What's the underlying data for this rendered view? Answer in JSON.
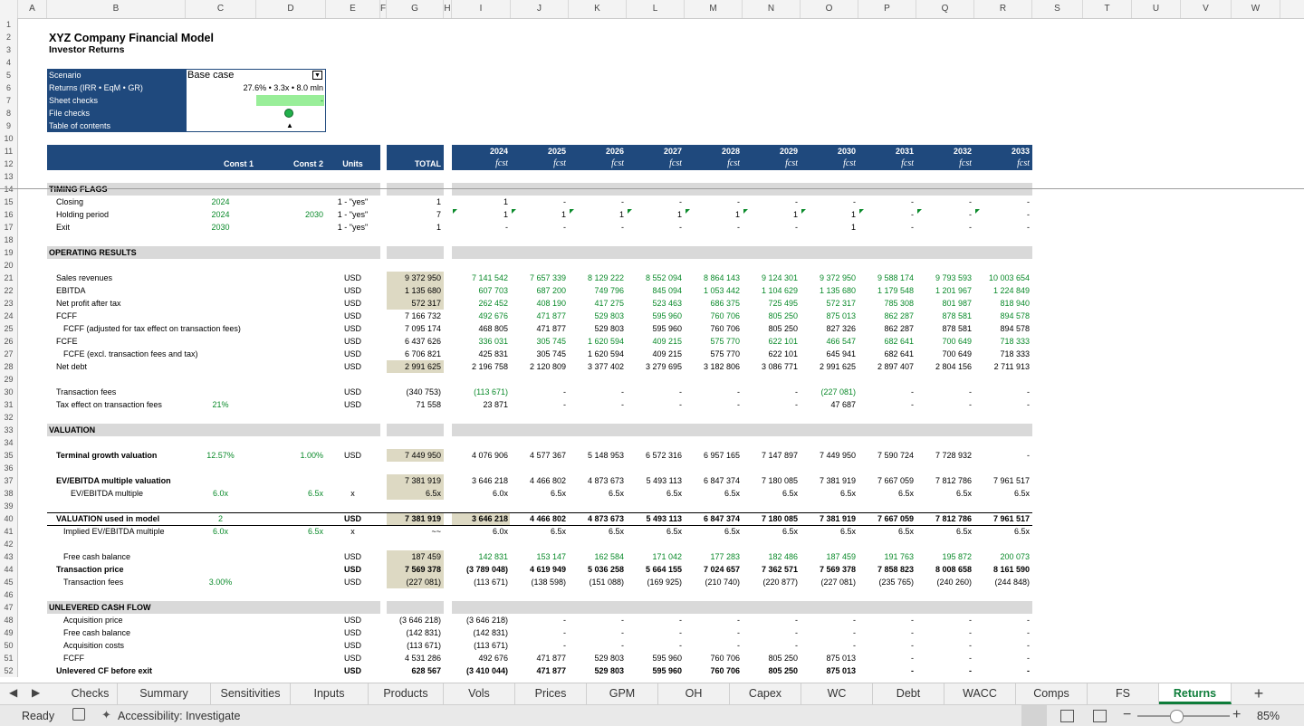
{
  "header": {
    "title": "XYZ Company Financial Model",
    "subtitle": "Investor Returns"
  },
  "columns": [
    "A",
    "B",
    "C",
    "D",
    "E",
    "F",
    "G",
    "H",
    "I",
    "J",
    "K",
    "L",
    "M",
    "N",
    "O",
    "P",
    "Q",
    "R",
    "S",
    "T",
    "U",
    "V",
    "W"
  ],
  "rows": [
    "1",
    "2",
    "3",
    "4",
    "5",
    "6",
    "7",
    "8",
    "9",
    "10",
    "11",
    "12",
    "13",
    "14",
    "15",
    "16",
    "17",
    "18",
    "19",
    "20",
    "21",
    "22",
    "23",
    "24",
    "25",
    "26",
    "27",
    "28",
    "29",
    "30",
    "31",
    "32",
    "33",
    "34",
    "35",
    "36",
    "37",
    "38",
    "39",
    "40",
    "41",
    "42",
    "43",
    "44",
    "45",
    "46",
    "47",
    "48",
    "49",
    "50",
    "51",
    "52"
  ],
  "info_box": {
    "scenario_label": "Scenario",
    "scenario_value": "Base case",
    "dropdown_icon": "dropdown-arrow-icon",
    "returns_label": "Returns (IRR • EqM • GR)",
    "returns_value": "27.6% • 3.3x • 8.0 mln",
    "sheet_checks_label": "Sheet checks",
    "sheet_checks_value": "-",
    "file_checks_label": "File checks",
    "file_checks_icon": "green-circle-icon",
    "toc_label": "Table of contents",
    "toc_icon": "up-arrow-icon",
    "toc_glyph": "▲"
  },
  "table_header": {
    "const1": "Const 1",
    "const2": "Const 2",
    "units": "Units",
    "total": "TOTAL",
    "years": [
      "2024",
      "2025",
      "2026",
      "2027",
      "2028",
      "2029",
      "2030",
      "2031",
      "2032",
      "2033"
    ],
    "fcst": "fcst"
  },
  "sections": {
    "timing": "TIMING FLAGS",
    "operating": "OPERATING RESULTS",
    "valuation": "VALUATION",
    "unlevered": "UNLEVERED CASH FLOW"
  },
  "timing_rows": [
    {
      "label": "Closing",
      "c1": "2024",
      "c2": "",
      "units": "1 - \"yes\"",
      "total": "1",
      "vals": [
        "1",
        "-",
        "-",
        "-",
        "-",
        "-",
        "-",
        "-",
        "-",
        "-"
      ]
    },
    {
      "label": "Holding period",
      "c1": "2024",
      "c2": "2030",
      "units": "1 - \"yes\"",
      "total": "7",
      "vals": [
        "1",
        "1",
        "1",
        "1",
        "1",
        "1",
        "1",
        "-",
        "-",
        "-"
      ]
    },
    {
      "label": "Exit",
      "c1": "2030",
      "c2": "",
      "units": "1 - \"yes\"",
      "total": "1",
      "vals": [
        "-",
        "-",
        "-",
        "-",
        "-",
        "-",
        "1",
        "-",
        "-",
        "-"
      ]
    }
  ],
  "operating_rows": [
    {
      "label": "Sales revenues",
      "units": "USD",
      "total": "9 372 950",
      "vals": [
        "7 141 542",
        "7 657 339",
        "8 129 222",
        "8 552 094",
        "8 864 143",
        "9 124 301",
        "9 372 950",
        "9 588 174",
        "9 793 593",
        "10 003 654"
      ]
    },
    {
      "label": "EBITDA",
      "units": "USD",
      "total": "1 135 680",
      "vals": [
        "607 703",
        "687 200",
        "749 796",
        "845 094",
        "1 053 442",
        "1 104 629",
        "1 135 680",
        "1 179 548",
        "1 201 967",
        "1 224 849"
      ]
    },
    {
      "label": "Net profit after tax",
      "units": "USD",
      "total": "572 317",
      "vals": [
        "262 452",
        "408 190",
        "417 275",
        "523 463",
        "686 375",
        "725 495",
        "572 317",
        "785 308",
        "801 987",
        "818 940"
      ]
    },
    {
      "label": "FCFF",
      "units": "USD",
      "total": "7 166 732",
      "vals": [
        "492 676",
        "471 877",
        "529 803",
        "595 960",
        "760 706",
        "805 250",
        "875 013",
        "862 287",
        "878 581",
        "894 578"
      ]
    },
    {
      "label": "FCFF (adjusted for tax effect on transaction fees)",
      "units": "USD",
      "total": "7 095 174",
      "vals": [
        "468 805",
        "471 877",
        "529 803",
        "595 960",
        "760 706",
        "805 250",
        "827 326",
        "862 287",
        "878 581",
        "894 578"
      ]
    },
    {
      "label": "FCFE",
      "units": "USD",
      "total": "6 437 626",
      "vals": [
        "336 031",
        "305 745",
        "1 620 594",
        "409 215",
        "575 770",
        "622 101",
        "466 547",
        "682 641",
        "700 649",
        "718 333"
      ]
    },
    {
      "label": "FCFE (excl. transaction fees and tax)",
      "units": "USD",
      "total": "6 706 821",
      "vals": [
        "425 831",
        "305 745",
        "1 620 594",
        "409 215",
        "575 770",
        "622 101",
        "645 941",
        "682 641",
        "700 649",
        "718 333"
      ]
    },
    {
      "label": "Net debt",
      "units": "USD",
      "total": "2 991 625",
      "vals": [
        "2 196 758",
        "2 120 809",
        "3 377 402",
        "3 279 695",
        "3 182 806",
        "3 086 771",
        "2 991 625",
        "2 897 407",
        "2 804 156",
        "2 711 913"
      ]
    }
  ],
  "fee_rows": [
    {
      "label": "Transaction fees",
      "c1": "",
      "units": "USD",
      "total": "(340 753)",
      "vals": [
        "(113 671)",
        "-",
        "-",
        "-",
        "-",
        "-",
        "(227 081)",
        "-",
        "-",
        "-"
      ]
    },
    {
      "label": "Tax effect on transaction fees",
      "c1": "21%",
      "units": "USD",
      "total": "71 558",
      "vals": [
        "23 871",
        "-",
        "-",
        "-",
        "-",
        "-",
        "47 687",
        "-",
        "-",
        "-"
      ]
    }
  ],
  "valuation_rows": {
    "terminal": {
      "label": "Terminal growth valuation",
      "c1": "12.57%",
      "c2": "1.00%",
      "units": "USD",
      "total": "7 449 950",
      "vals": [
        "4 076 906",
        "4 577 367",
        "5 148 953",
        "6 572 316",
        "6 957 165",
        "7 147 897",
        "7 449 950",
        "7 590 724",
        "7 728 932",
        "-"
      ]
    },
    "ev": {
      "label": "EV/EBITDA multiple valuation",
      "units": "",
      "total": "7 381 919",
      "vals": [
        "3 646 218",
        "4 466 802",
        "4 873 673",
        "5 493 113",
        "6 847 374",
        "7 180 085",
        "7 381 919",
        "7 667 059",
        "7 812 786",
        "7 961 517"
      ]
    },
    "evmult": {
      "label": "EV/EBITDA multiple",
      "c1": "6.0x",
      "c2": "6.5x",
      "units": "x",
      "total": "6.5x",
      "vals": [
        "6.0x",
        "6.5x",
        "6.5x",
        "6.5x",
        "6.5x",
        "6.5x",
        "6.5x",
        "6.5x",
        "6.5x",
        "6.5x"
      ]
    },
    "used": {
      "label": "VALUATION used in model",
      "c1": "2",
      "units": "USD",
      "total": "7 381 919",
      "vals": [
        "3 646 218",
        "4 466 802",
        "4 873 673",
        "5 493 113",
        "6 847 374",
        "7 180 085",
        "7 381 919",
        "7 667 059",
        "7 812 786",
        "7 961 517"
      ]
    },
    "implied": {
      "label": "Implied EV/EBITDA multiple",
      "c1": "6.0x",
      "c2": "6.5x",
      "units": "x",
      "total": "~~",
      "vals": [
        "6.0x",
        "6.5x",
        "6.5x",
        "6.5x",
        "6.5x",
        "6.5x",
        "6.5x",
        "6.5x",
        "6.5x",
        "6.5x"
      ]
    },
    "fcb": {
      "label": "Free cash balance",
      "units": "USD",
      "total": "187 459",
      "vals": [
        "142 831",
        "153 147",
        "162 584",
        "171 042",
        "177 283",
        "182 486",
        "187 459",
        "191 763",
        "195 872",
        "200 073"
      ]
    },
    "price": {
      "label": "Transaction price",
      "units": "USD",
      "total": "7 569 378",
      "vals": [
        "(3 789 048)",
        "4 619 949",
        "5 036 258",
        "5 664 155",
        "7 024 657",
        "7 362 571",
        "7 569 378",
        "7 858 823",
        "8 008 658",
        "8 161 590"
      ]
    },
    "tfees": {
      "label": "Transaction fees",
      "c1": "3.00%",
      "units": "USD",
      "total": "(227 081)",
      "vals": [
        "(113 671)",
        "(138 598)",
        "(151 088)",
        "(169 925)",
        "(210 740)",
        "(220 877)",
        "(227 081)",
        "(235 765)",
        "(240 260)",
        "(244 848)"
      ]
    }
  },
  "unlevered_rows": [
    {
      "label": "Acquisition price",
      "units": "USD",
      "total": "(3 646 218)",
      "vals": [
        "(3 646 218)",
        "-",
        "-",
        "-",
        "-",
        "-",
        "-",
        "-",
        "-",
        "-"
      ]
    },
    {
      "label": "Free cash balance",
      "units": "USD",
      "total": "(142 831)",
      "vals": [
        "(142 831)",
        "-",
        "-",
        "-",
        "-",
        "-",
        "-",
        "-",
        "-",
        "-"
      ]
    },
    {
      "label": "Acquisition costs",
      "units": "USD",
      "total": "(113 671)",
      "vals": [
        "(113 671)",
        "-",
        "-",
        "-",
        "-",
        "-",
        "-",
        "-",
        "-",
        "-"
      ]
    },
    {
      "label": "FCFF",
      "units": "USD",
      "total": "4 531 286",
      "vals": [
        "492 676",
        "471 877",
        "529 803",
        "595 960",
        "760 706",
        "805 250",
        "875 013",
        "-",
        "-",
        "-"
      ]
    },
    {
      "label": "Unlevered CF before exit",
      "units": "USD",
      "total": "628 567",
      "vals": [
        "(3 410 044)",
        "471 877",
        "529 803",
        "595 960",
        "760 706",
        "805 250",
        "875 013",
        "-",
        "-",
        "-"
      ]
    }
  ],
  "tabs": [
    "Checks",
    "Summary",
    "Sensitivities",
    "Inputs",
    "Products",
    "Vols",
    "Prices",
    "GPM",
    "OH",
    "Capex",
    "WC",
    "Debt",
    "WACC",
    "Comps",
    "FS",
    "Returns"
  ],
  "active_tab": "Returns",
  "status": {
    "ready": "Ready",
    "accessibility": "Accessibility: Investigate",
    "zoom": "85%"
  },
  "colors": {
    "navy": "#1f497d",
    "green": "#0a8a2a",
    "band": "#d9d9d9",
    "tan": "#ddd9c3",
    "lightgreen": "#99ee99",
    "accent": "#0e7d3a"
  }
}
